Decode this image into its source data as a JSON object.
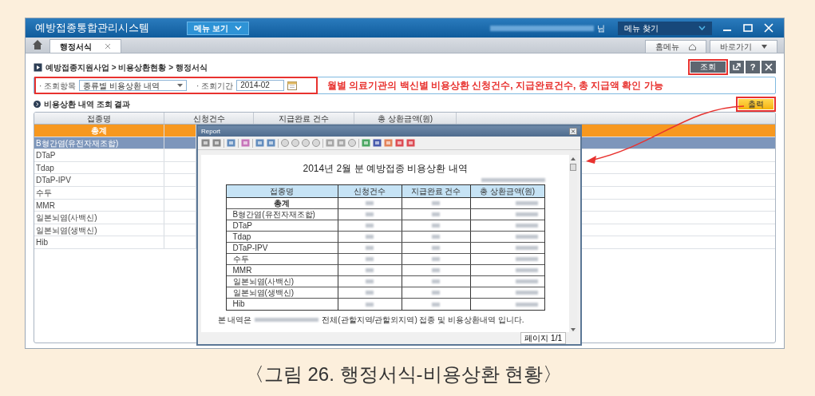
{
  "window": {
    "title": "예방접종통합관리시스템",
    "menu_button": "메뉴 보기",
    "user_suffix": "님",
    "menu_search": "메뉴 찾기"
  },
  "tabs": [
    {
      "label": "행정서식",
      "selected": true
    }
  ],
  "top_links": [
    {
      "label": "홈메뉴",
      "kind": "home"
    },
    {
      "label": "바로가기",
      "kind": "dropdown"
    }
  ],
  "breadcrumb": "예방접종지원사업 > 비용상환현황 > 행정서식",
  "search_button": "조회",
  "help_button": "?",
  "filters": [
    {
      "label": "· 조회항목",
      "kind": "select",
      "value": "종류별 비용상환 내역"
    },
    {
      "label": "· 조회기간",
      "kind": "date",
      "value": "2014-02"
    }
  ],
  "annotation": "월별 의료기관의 백신별 비용상환 신청건수, 지급완료건수, 총 지급액 확인 가능",
  "section_title": "비용상환 내역 조회 결과",
  "print_button": "출력",
  "grid": {
    "columns": [
      "접종명",
      "신청건수",
      "지급완료 건수",
      "총 상환금액(원)"
    ],
    "rows": [
      {
        "name": "총계",
        "kind": "total",
        "selected": false
      },
      {
        "name": "B형간염(유전자재조합)",
        "kind": "item",
        "selected": true
      },
      {
        "name": "DTaP",
        "kind": "item",
        "selected": false
      },
      {
        "name": "Tdap",
        "kind": "item",
        "selected": false
      },
      {
        "name": "DTaP-IPV",
        "kind": "item",
        "selected": false
      },
      {
        "name": "수두",
        "kind": "item",
        "selected": false
      },
      {
        "name": "MMR",
        "kind": "item",
        "selected": false
      },
      {
        "name": "일본뇌염(사백신)",
        "kind": "item",
        "selected": false
      },
      {
        "name": "일본뇌염(생백신)",
        "kind": "item",
        "selected": false
      },
      {
        "name": "Hib",
        "kind": "item",
        "selected": false
      }
    ]
  },
  "report": {
    "title": "Report",
    "heading": "2014년 2월 분 예방접종 비용상환 내역",
    "columns": [
      "접종명",
      "신청건수",
      "지급완료 건수",
      "총 상환금액(원)"
    ],
    "rows": [
      {
        "name": "총계",
        "kind": "total"
      },
      {
        "name": "B형간염(유전자재조합)",
        "kind": "item"
      },
      {
        "name": "DTaP",
        "kind": "item"
      },
      {
        "name": "Tdap",
        "kind": "item"
      },
      {
        "name": "DTaP-IPV",
        "kind": "item"
      },
      {
        "name": "수두",
        "kind": "item"
      },
      {
        "name": "MMR",
        "kind": "item"
      },
      {
        "name": "일본뇌염(사백신)",
        "kind": "item"
      },
      {
        "name": "일본뇌염(생백신)",
        "kind": "item"
      },
      {
        "name": "Hib",
        "kind": "item"
      }
    ],
    "note_before": "본 내역은",
    "note_after": "전체(관할지역/관할외지역) 접종 및 비용상환내역 입니다.",
    "page": "페이지 1/1"
  },
  "caption": "〈그림 26. 행정서식-비용상환 현황〉"
}
